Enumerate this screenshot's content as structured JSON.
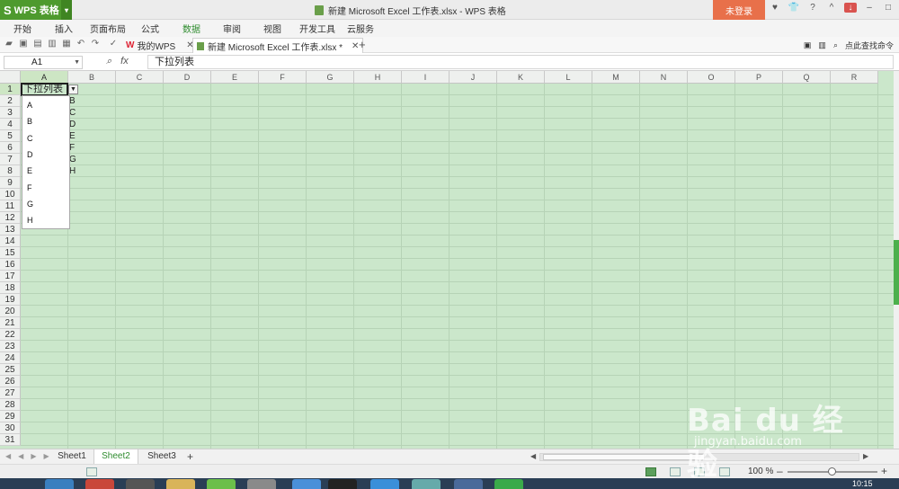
{
  "app": {
    "button_label": "WPS 表格",
    "window_title": "新建 Microsoft Excel 工作表.xlsx - WPS 表格",
    "login_button": "未登录"
  },
  "menu": [
    "开始",
    "插入",
    "页面布局",
    "公式",
    "数据",
    "审阅",
    "视图",
    "开发工具",
    "云服务"
  ],
  "menu_active": "数据",
  "tabs": {
    "my_wps": "我的WPS",
    "document": "新建 Microsoft Excel 工作表.xlsx *",
    "command_search": "点此查找命令"
  },
  "formula_bar": {
    "name_box": "A1",
    "fx_label": "fx",
    "content": "下拉列表"
  },
  "grid": {
    "columns": [
      "A",
      "B",
      "C",
      "D",
      "E",
      "F",
      "G",
      "H",
      "I",
      "J",
      "K",
      "L",
      "M",
      "N",
      "O",
      "P",
      "Q",
      "R"
    ],
    "rows": [
      "1",
      "2",
      "3",
      "4",
      "5",
      "6",
      "7",
      "8",
      "9",
      "10",
      "11",
      "12",
      "13",
      "14",
      "15",
      "16",
      "17",
      "18",
      "19",
      "20",
      "21",
      "22",
      "23",
      "24",
      "25",
      "26",
      "27",
      "28",
      "29",
      "30",
      "31"
    ],
    "a1_value": "下拉列表",
    "column_b_values": [
      "B",
      "C",
      "D",
      "E",
      "F",
      "G",
      "H"
    ],
    "dropdown_items": [
      "A",
      "B",
      "C",
      "D",
      "E",
      "F",
      "G",
      "H"
    ]
  },
  "sheets": {
    "tabs": [
      "Sheet1",
      "Sheet2",
      "Sheet3"
    ],
    "active": "Sheet2"
  },
  "status": {
    "zoom": "100 %"
  },
  "taskbar": {
    "clock": "10:15"
  },
  "watermark": {
    "brand": "Bai du 经验",
    "url": "jingyan.baidu.com"
  },
  "colors": {
    "grid_bg": "#cbe7cb",
    "app_green": "#4e9a2e",
    "login_orange": "#e8704a"
  }
}
